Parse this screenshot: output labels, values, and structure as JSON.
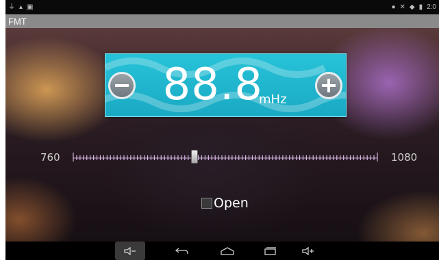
{
  "app": {
    "title": "FMT"
  },
  "status_bar": {
    "time": "2:0",
    "left_icons": [
      "usb-icon",
      "debug-icon",
      "image-icon"
    ],
    "right_icons": [
      "location-icon",
      "silent-icon",
      "wifi-icon",
      "battery-icon"
    ]
  },
  "radio": {
    "frequency": "88.8",
    "unit": "mHz",
    "range_min": "760",
    "range_max": "1080",
    "slider_value": 888,
    "slider_min": 760,
    "slider_max": 1080
  },
  "open_option": {
    "label": "Open",
    "checked": false
  },
  "nav_bar": {
    "buttons": [
      "volume-down-icon",
      "back-icon",
      "home-icon",
      "recent-apps-icon",
      "volume-up-icon"
    ]
  },
  "colors": {
    "panel": "#1fb4cc",
    "title_bar": "#8a8a8a",
    "status_bar": "#0a0a0a"
  }
}
